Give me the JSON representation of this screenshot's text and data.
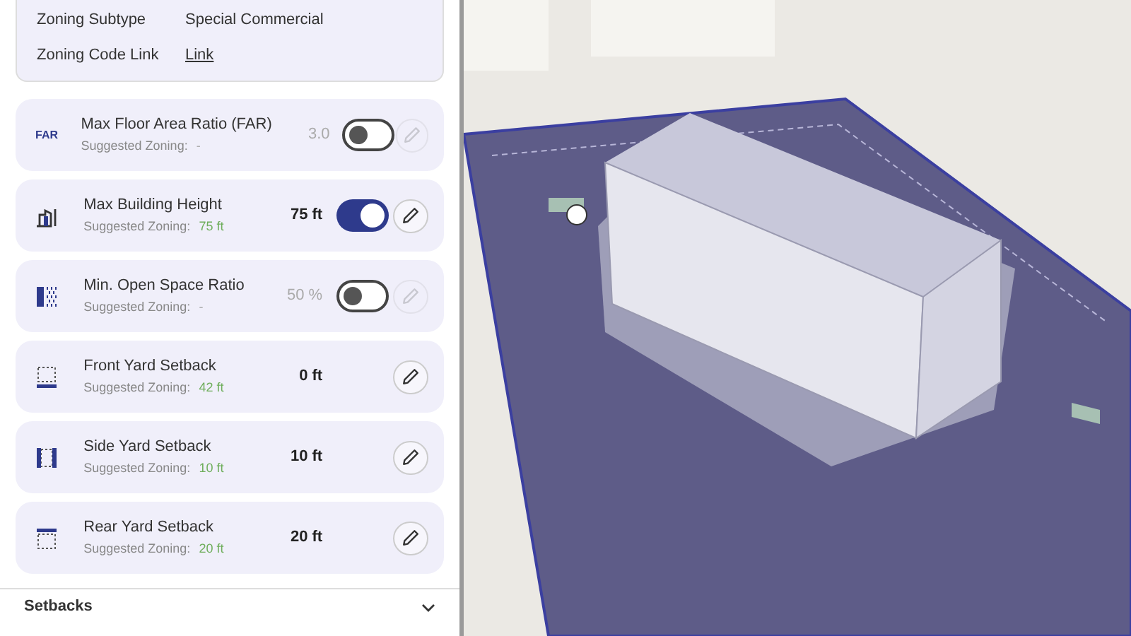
{
  "zoning_info": [
    {
      "label": "Zoning Subtype",
      "value": "Special Commercial",
      "kind": "text"
    },
    {
      "label": "Zoning Code Link",
      "value": "Link",
      "kind": "link"
    }
  ],
  "rules": [
    {
      "kind": "toggle",
      "icon_text": "FAR",
      "name": "Max Floor Area Ratio (FAR)",
      "suggested_label": "Suggested Zoning:",
      "suggested": "-",
      "value": "3.0",
      "on": false
    },
    {
      "kind": "toggle",
      "name": "Max Building Height",
      "suggested_label": "Suggested Zoning:",
      "suggested": "75 ft",
      "value": "75 ft",
      "on": true
    },
    {
      "kind": "toggle",
      "name": "Min. Open Space Ratio",
      "suggested_label": "Suggested Zoning:",
      "suggested": "-",
      "value": "50 %",
      "on": false
    },
    {
      "kind": "plain",
      "name": "Front Yard Setback",
      "suggested_label": "Suggested Zoning:",
      "suggested": "42 ft",
      "value": "0 ft"
    },
    {
      "kind": "plain",
      "name": "Side Yard Setback",
      "suggested_label": "Suggested Zoning:",
      "suggested": "10 ft",
      "value": "10 ft"
    },
    {
      "kind": "plain",
      "name": "Rear Yard Setback",
      "suggested_label": "Suggested Zoning:",
      "suggested": "20 ft",
      "value": "20 ft"
    }
  ],
  "section": {
    "title": "Setbacks",
    "expanded": false
  }
}
